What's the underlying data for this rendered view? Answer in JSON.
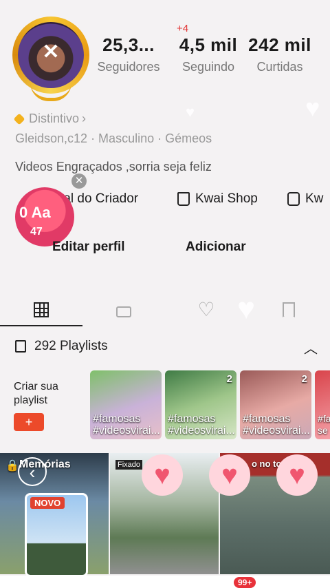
{
  "profile": {
    "stats": [
      {
        "value": "25,3...",
        "label": "Seguidores"
      },
      {
        "value": "4,5 mil",
        "label": "Seguindo"
      },
      {
        "value": "242 mil",
        "label": "Curtidas"
      }
    ],
    "seguindo_delta": "+4",
    "badge_label": "Distintivo",
    "info": "Gleidson,c12 · Masculino · Gémeos",
    "bio": "Videos Engraçados ,sorria seja feliz"
  },
  "tools": {
    "creator_label": "ral do Criador",
    "shop_label": "Kwai Shop",
    "more_label": "Kw"
  },
  "floating": {
    "big_text": "0 Aa",
    "coin_count": "47"
  },
  "actions": {
    "edit_label": "Editar perfil",
    "add_label": "Adicionar"
  },
  "playlists": {
    "title": "292 Playlists",
    "create_label": "Criar sua playlist",
    "items": [
      {
        "caption": "#famosas #videosvirai...",
        "count": ""
      },
      {
        "caption": "#famosas #videosvirai...",
        "count": "2"
      },
      {
        "caption": "#famosas #videosvirai...",
        "count": "2"
      },
      {
        "caption": "#fa se",
        "count": ""
      }
    ]
  },
  "grid": {
    "memories_label": "Memórias",
    "pinned_label": "Fixado",
    "novo_label": "NOVO",
    "tile3_tag": "o no top"
  },
  "nav": {
    "badge": "99+"
  },
  "colors": {
    "accent": "#ec4a2a",
    "heart": "#f0566f",
    "badge": "#e8323a"
  }
}
